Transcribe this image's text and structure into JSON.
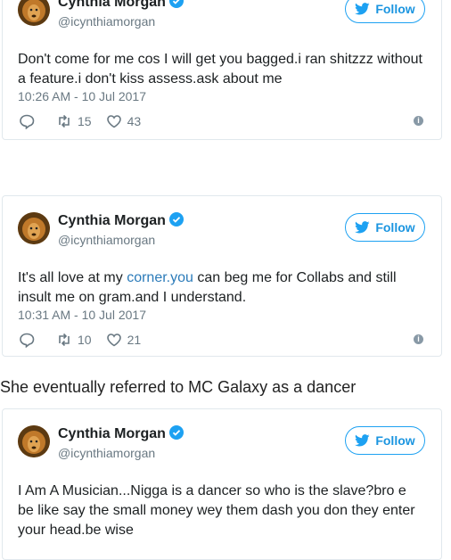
{
  "colors": {
    "accent": "#1da1f2",
    "link": "#2b7bb9",
    "muted": "#697882",
    "border": "#e1e8ed"
  },
  "caption": "She eventually referred to MC Galaxy as a dancer",
  "tweets": [
    {
      "name": "Cynthia Morgan",
      "handle": "@icynthiamorgan",
      "follow": "Follow",
      "text": "Don't come for me cos I will get you bagged.i ran shitzzz without a feature.i don't kiss assess.ask about me",
      "time": "10:26 AM - 10 Jul 2017",
      "retweets": "15",
      "likes": "43"
    },
    {
      "name": "Cynthia Morgan",
      "handle": "@icynthiamorgan",
      "follow": "Follow",
      "text_before": "It's all love at my ",
      "text_link": "corner.you",
      "text_after": " can beg me for Collabs and still insult me on gram.and I understand.",
      "time": "10:31 AM - 10 Jul 2017",
      "retweets": "10",
      "likes": "21"
    },
    {
      "name": "Cynthia Morgan",
      "handle": "@icynthiamorgan",
      "follow": "Follow",
      "text": "I Am A Musician...Nigga is a dancer so who is the slave?bro e be like say the small money wey them dash you don they enter your head.be wise"
    }
  ]
}
